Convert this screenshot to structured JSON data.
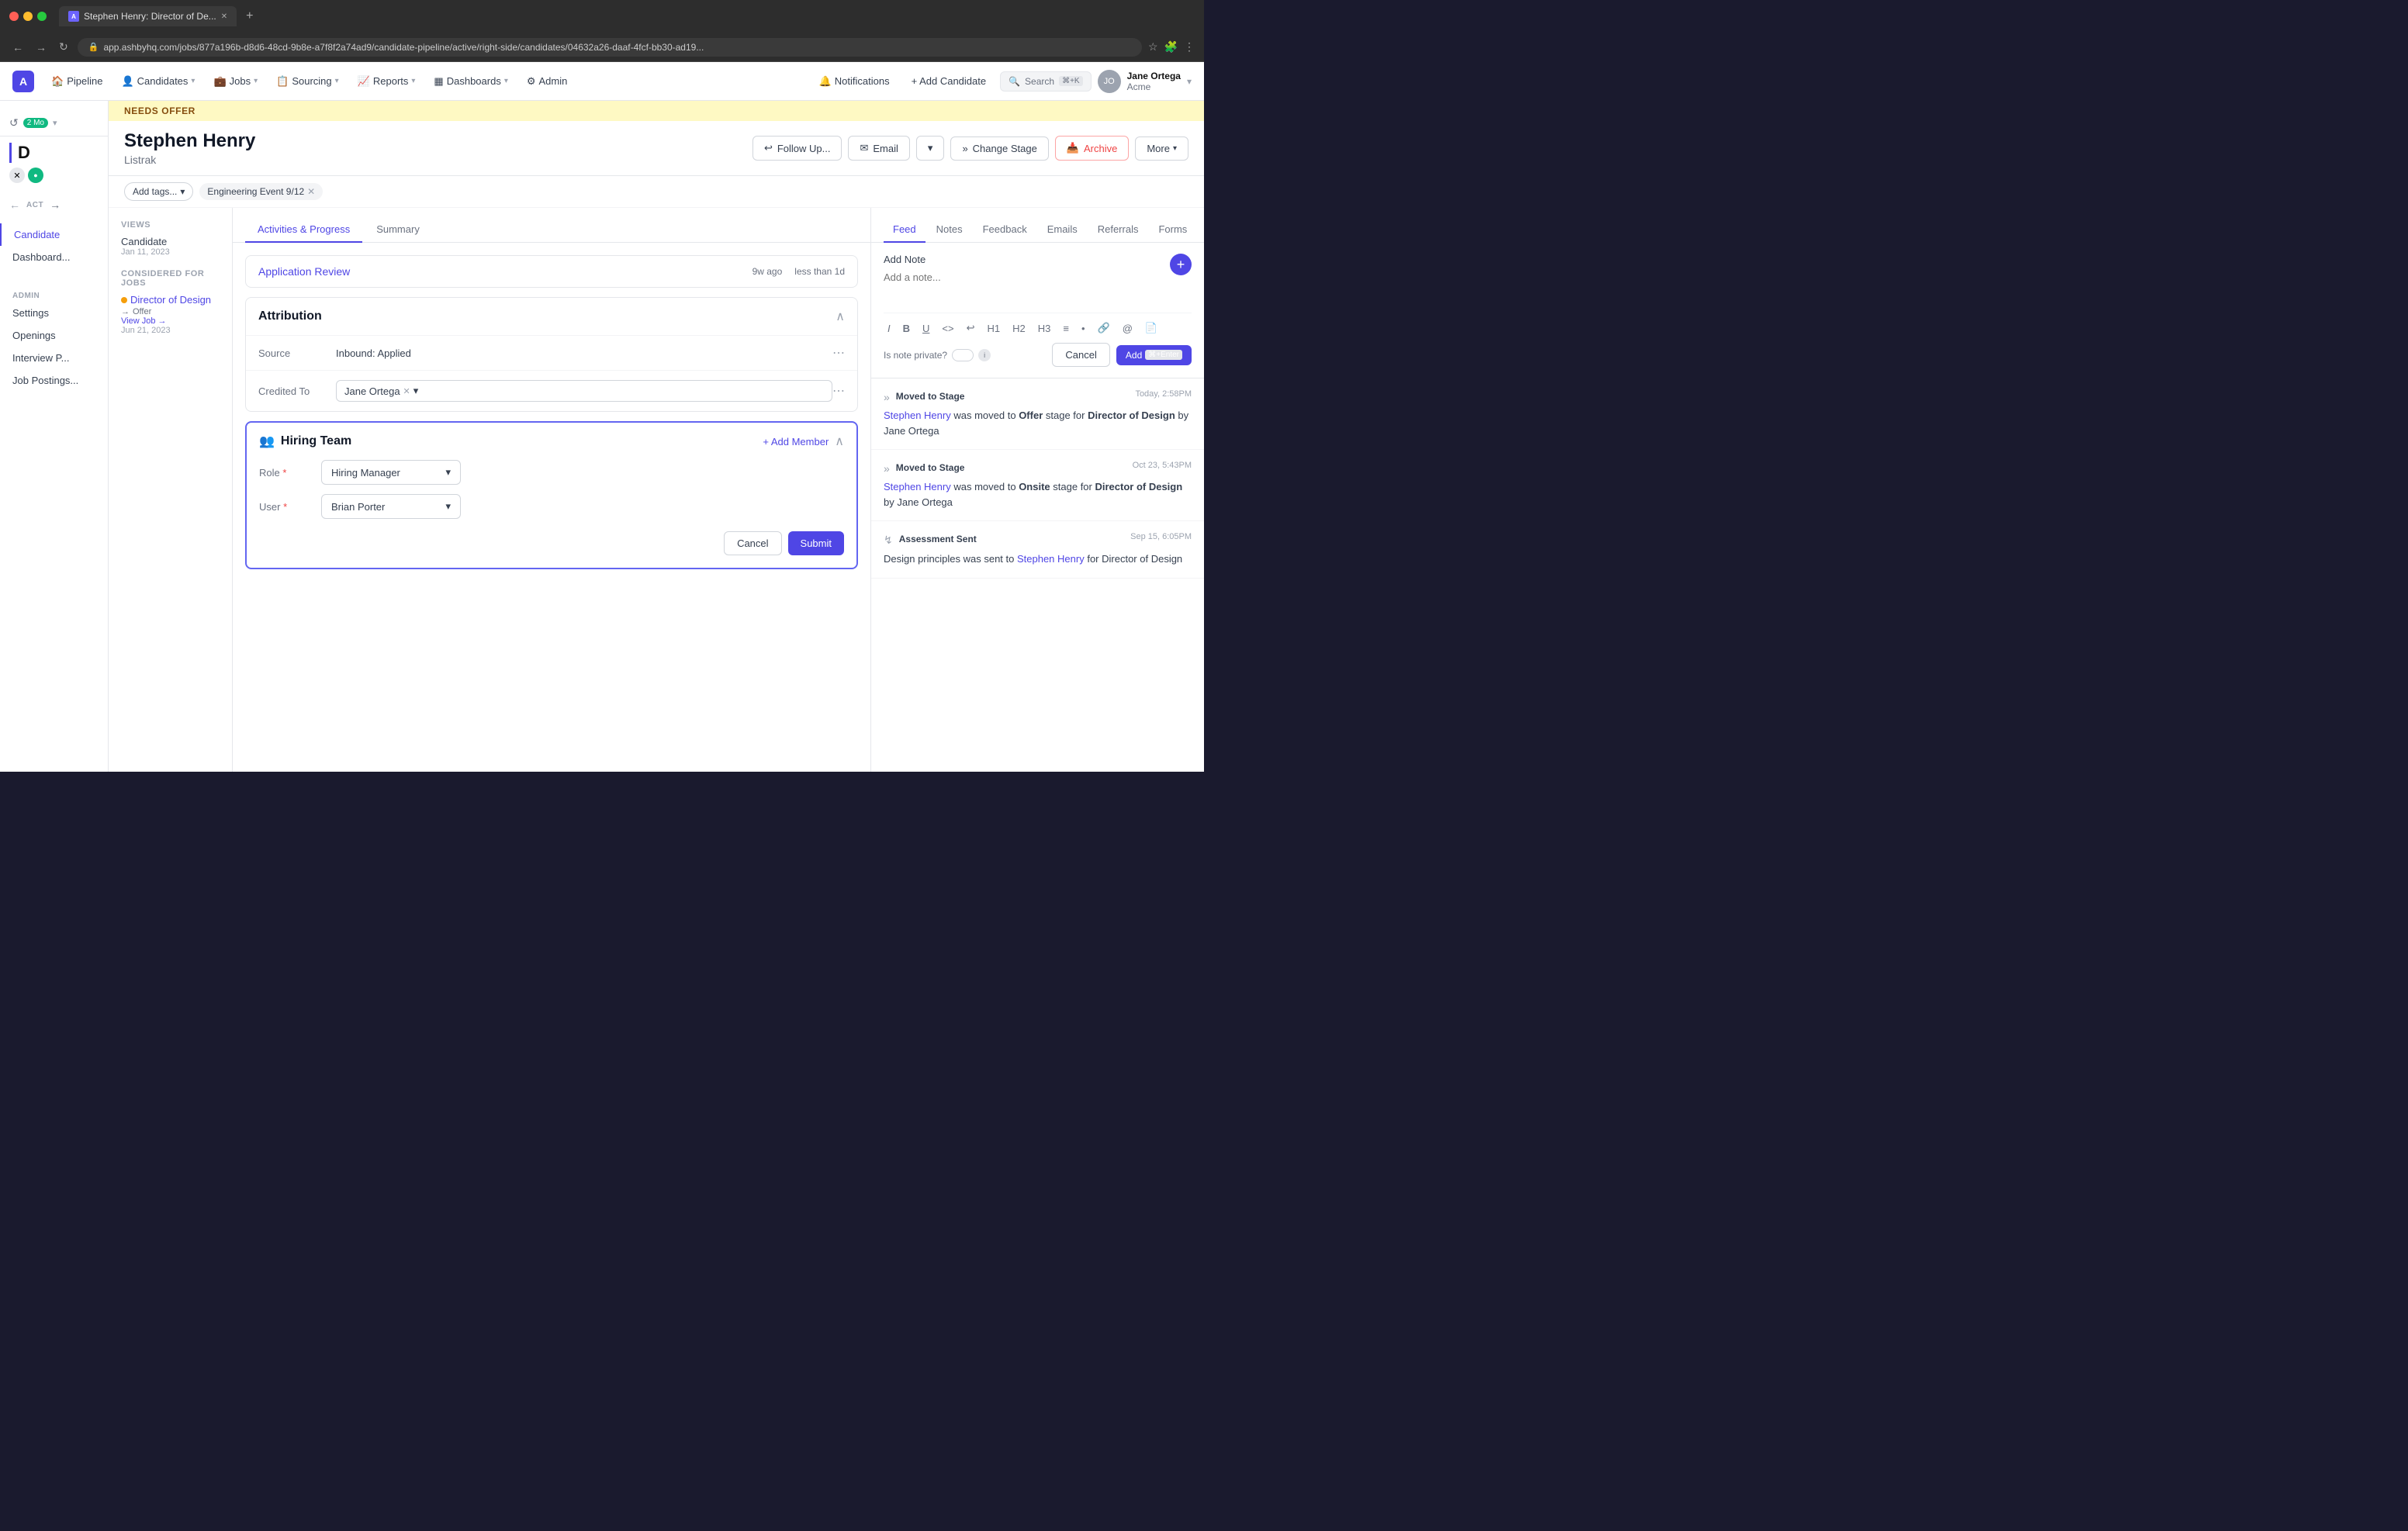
{
  "browser": {
    "tab_title": "Stephen Henry: Director of De...",
    "url": "app.ashbyhq.com/jobs/877a196b-d8d6-48cd-9b8e-a7f8f2a74ad9/candidate-pipeline/active/right-side/candidates/04632a26-daaf-4fcf-bb30-ad19...",
    "new_tab": "+",
    "nav_back": "←",
    "nav_forward": "→",
    "nav_reload": "↻"
  },
  "nav": {
    "logo": "A",
    "items": [
      {
        "label": "Pipeline",
        "has_dropdown": false
      },
      {
        "label": "Candidates",
        "has_dropdown": true
      },
      {
        "label": "Jobs",
        "has_dropdown": true
      },
      {
        "label": "Sourcing",
        "has_dropdown": true
      },
      {
        "label": "Reports",
        "has_dropdown": true
      },
      {
        "label": "Dashboards",
        "has_dropdown": true
      },
      {
        "label": "Admin",
        "has_dropdown": false
      }
    ],
    "notifications": "Notifications",
    "add_candidate": "+ Add Candidate",
    "search_label": "Search",
    "search_kbd": "⌘+K",
    "user_name": "Jane Ortega",
    "user_org": "Acme"
  },
  "sidebar": {
    "views_label": "VIEWS",
    "candidate_label": "Candidate",
    "candidate_date": "Jan 11, 2023",
    "admin_label": "ADMIN",
    "admin_items": [
      {
        "label": "Settings"
      },
      {
        "label": "Openings"
      },
      {
        "label": "Interview P..."
      },
      {
        "label": "Job Postings..."
      }
    ]
  },
  "history": {
    "badge": "2 Mo"
  },
  "candidate": {
    "banner": "NEEDS OFFER",
    "name": "Stephen Henry",
    "company": "Listrak",
    "tags": [
      "Engineering Event 9/12"
    ],
    "add_tags": "Add tags..."
  },
  "considered_for": {
    "title": "CONSIDERED FOR JOBS",
    "job_name": "Director of Design",
    "job_dot_color": "#f59e0b",
    "job_stage_arrow": "→",
    "job_stage": "Offer",
    "view_job": "View Job →",
    "job_date": "Jun 21, 2023"
  },
  "tabs": {
    "main": [
      {
        "label": "Activities & Progress",
        "active": true
      },
      {
        "label": "Summary"
      }
    ],
    "feed": [
      {
        "label": "Feed",
        "active": true
      },
      {
        "label": "Notes"
      },
      {
        "label": "Feedback"
      },
      {
        "label": "Emails"
      },
      {
        "label": "Referrals"
      },
      {
        "label": "Forms"
      }
    ]
  },
  "activity": {
    "title": "Application Review",
    "time_ago": "9w ago",
    "duration": "less than 1d"
  },
  "attribution": {
    "title": "Attribution",
    "source_label": "Source",
    "source_value": "Inbound: Applied",
    "credited_label": "Credited To",
    "credited_value": "Jane Ortega"
  },
  "hiring_team": {
    "title": "Hiring Team",
    "add_member": "+ Add Member",
    "role_label": "Role",
    "role_required": "*",
    "role_value": "Hiring Manager",
    "user_label": "User",
    "user_required": "*",
    "user_value": "Brian Porter",
    "cancel_btn": "Cancel",
    "submit_btn": "Submit"
  },
  "add_note": {
    "title": "Add Note",
    "placeholder": "Add a note...",
    "private_label": "Is note private?",
    "cancel_btn": "Cancel",
    "add_btn": "Add",
    "add_shortcut": "⌘+Enter",
    "toolbar": [
      "I",
      "B",
      "U",
      "<>",
      "↩",
      "H1",
      "H2",
      "H3",
      "≡",
      "•",
      "🔗",
      "@",
      "📄"
    ]
  },
  "feed_items": [
    {
      "type": "Moved to Stage",
      "date": "Today, 2:58PM",
      "person_link": "Stephen Henry",
      "action": "was moved to",
      "stage": "Offer",
      "job": "Director of Design",
      "by": "by Jane Ortega"
    },
    {
      "type": "Moved to Stage",
      "date": "Oct 23, 5:43PM",
      "person_link": "Stephen Henry",
      "action": "was moved to",
      "stage": "Onsite",
      "job": "Director of Design",
      "by": "by Jane Ortega"
    },
    {
      "type": "Assessment Sent",
      "date": "Sep 15, 6:05PM",
      "assessment": "Design principles",
      "person_link": "Stephen Henry",
      "job": "Director of Design",
      "text_pre": "Design principles was sent to ",
      "text_post": " for Director of Design"
    }
  ],
  "more_btn": "More"
}
